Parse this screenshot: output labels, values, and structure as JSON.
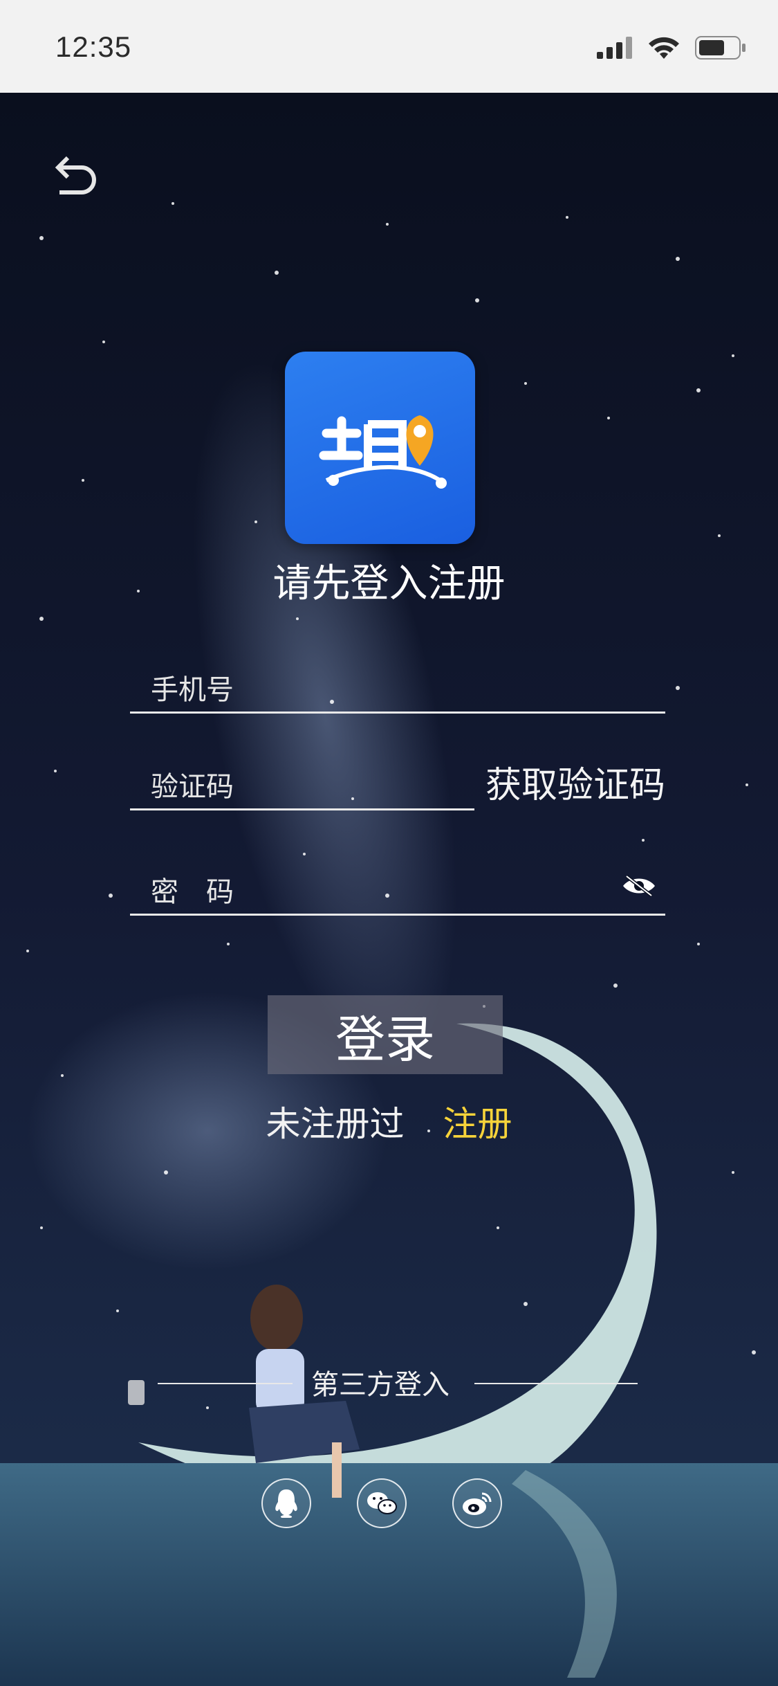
{
  "status_bar": {
    "time": "12:35"
  },
  "login": {
    "title": "请先登入注册",
    "phone_placeholder": "手机号",
    "code_placeholder": "验证码",
    "get_code_label": "获取验证码",
    "password_placeholder": "密　码",
    "login_button": "登录",
    "not_registered": "未注册过",
    "register_link": "注册",
    "third_party_label": "第三方登入"
  },
  "social": [
    {
      "icon": "qq-icon"
    },
    {
      "icon": "wechat-icon"
    },
    {
      "icon": "weibo-icon"
    }
  ],
  "colors": {
    "register_link": "#f7d33a",
    "logo_blue": "#1f6ae8",
    "logo_pin": "#f5a623"
  }
}
